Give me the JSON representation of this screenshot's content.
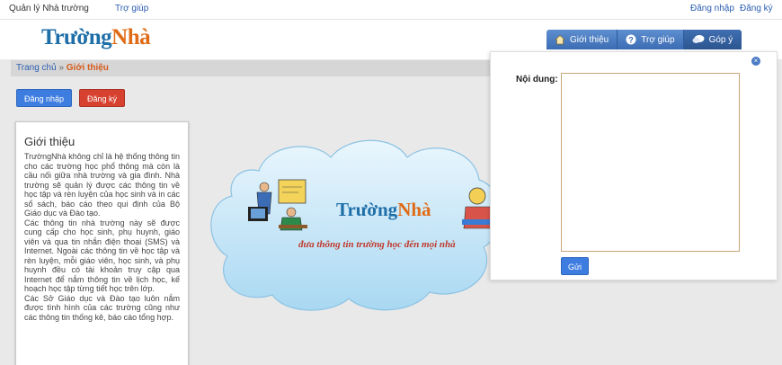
{
  "topbar": {
    "site_name": "Quản lý Nhà trường",
    "help": "Trợ giúp",
    "login": "Đăng nhập",
    "register": "Đăng ký"
  },
  "logo": {
    "part1": "Trường",
    "part2": "Nhà"
  },
  "nav": [
    {
      "label": "Giới thiệu",
      "icon": "home-icon"
    },
    {
      "label": "Trợ giúp",
      "icon": "question-icon"
    },
    {
      "label": "Góp ý",
      "icon": "speech-bubble-icon"
    }
  ],
  "breadcrumb": {
    "home": "Trang chủ",
    "sep": "»",
    "current": "Giới thiệu"
  },
  "buttons": {
    "login": "Đăng nhập",
    "register": "Đăng ký"
  },
  "intro": {
    "title": "Giới thiệu",
    "p1": "TrườngNhà không chỉ là hệ thống thông tin cho các trường học phổ thông mà còn là cầu nối giữa nhà trường và gia đình. Nhà trường sẽ quản lý được các thông tin về học tập và rèn luyện của học sinh và in các sổ sách, báo cáo theo qui định của Bộ Giáo dục và Đào tạo.",
    "p2": "Các thông tin nhà trường này sẽ được cung cấp cho học sinh, phụ huynh, giáo viên và qua tin nhắn điện thoại (SMS) và Internet. Ngoài các thông tin về học tập và rèn luyện, mỗi giáo viên, học sinh, và phụ huynh đều có tài khoản truy cập qua Internet để nắm thông tin về lịch học, kế hoạch học tập từng tiết học trên lớp.",
    "p3": "Các Sở Giáo dục và Đào tạo luôn nắm được tình hình của các trường cũng như các thông tin thống kê, báo cáo tổng hợp."
  },
  "banner": {
    "brand1": "Trường",
    "brand2": "Nhà",
    "slogan": "đưa thông tin trường học đến mọi nhà"
  },
  "feedback": {
    "label": "Nội dung:",
    "value": "",
    "send": "Gửi",
    "close": "×"
  },
  "colors": {
    "brand_blue": "#1e6ea8",
    "brand_orange": "#e06b16",
    "accent": "#3e7de0",
    "danger": "#d7412f"
  }
}
